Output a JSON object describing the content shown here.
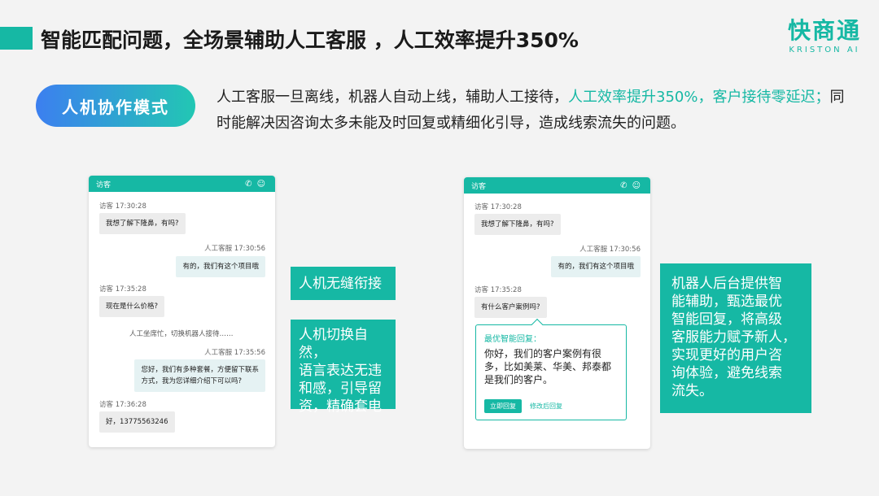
{
  "header": {
    "title": "智能匹配问题，全场景辅助人工客服 ，人工效率提升350%"
  },
  "logo": {
    "cn": "快商通",
    "en": "KRISTON AI"
  },
  "mode": {
    "label": "人机协作模式"
  },
  "intro": {
    "part1": "人工客服一旦离线，机器人自动上线，辅助人工接待，",
    "highlight": "人工效率提升350%，客户接待零延迟；",
    "part2": "同时能解决因咨询太多未能及时回复或精细化引导，造成线索流失的问题。"
  },
  "chat_left": {
    "header_title": "访客",
    "phone_icon": "phone-icon",
    "user_icon": "user-icon",
    "m1_meta": "访客 17:30:28",
    "m1_text": "我想了解下隆鼻，有吗?",
    "m2_meta": "人工客服 17:30:56",
    "m2_text": "有的，我们有这个项目哦",
    "m3_meta": "访客 17:35:28",
    "m3_text": "现在是什么价格?",
    "sys_text": "人工坐席忙，切换机器人接待……",
    "m4_meta": "人工客服 17:35:56",
    "m4_line1": "您好，我们有多种套餐，方便留下联系",
    "m4_line2": "方式，我为您详细介绍下可以吗?",
    "m5_meta": "访客 17:36:28",
    "m5_text": "好，13775563246"
  },
  "callouts_left": {
    "c1": "人机无缝衔接",
    "c2_l1": "人机切换自然，",
    "c2_l2": "语言表达无违",
    "c2_l3": "和感，引导留",
    "c2_l4": "资，精确套电"
  },
  "chat_right": {
    "header_title": "访客",
    "m1_meta": "访客 17:30:28",
    "m1_text": "我想了解下隆鼻，有吗?",
    "m2_meta": "人工客服 17:30:56",
    "m2_text": "有的，我们有这个项目哦",
    "m3_meta": "访客 17:35:28",
    "m3_text": "有什么客户案例吗?",
    "suggest_title": "最优智能回复：",
    "suggest_l1": "你好，我们的客户案例有很",
    "suggest_l2": "多，比如美莱、华美、邦泰都",
    "suggest_l3": "是我们的客户。",
    "send_label": "立即回复",
    "edit_label": "修改后回复"
  },
  "callout_right": {
    "l1": "机器人后台提供智",
    "l2": "能辅助，甄选最优",
    "l3": "智能回复，将高级",
    "l4": "客服能力赋予新人，",
    "l5": "实现更好的用户咨",
    "l6": "询体验，避免线索",
    "l7": "流失。"
  }
}
